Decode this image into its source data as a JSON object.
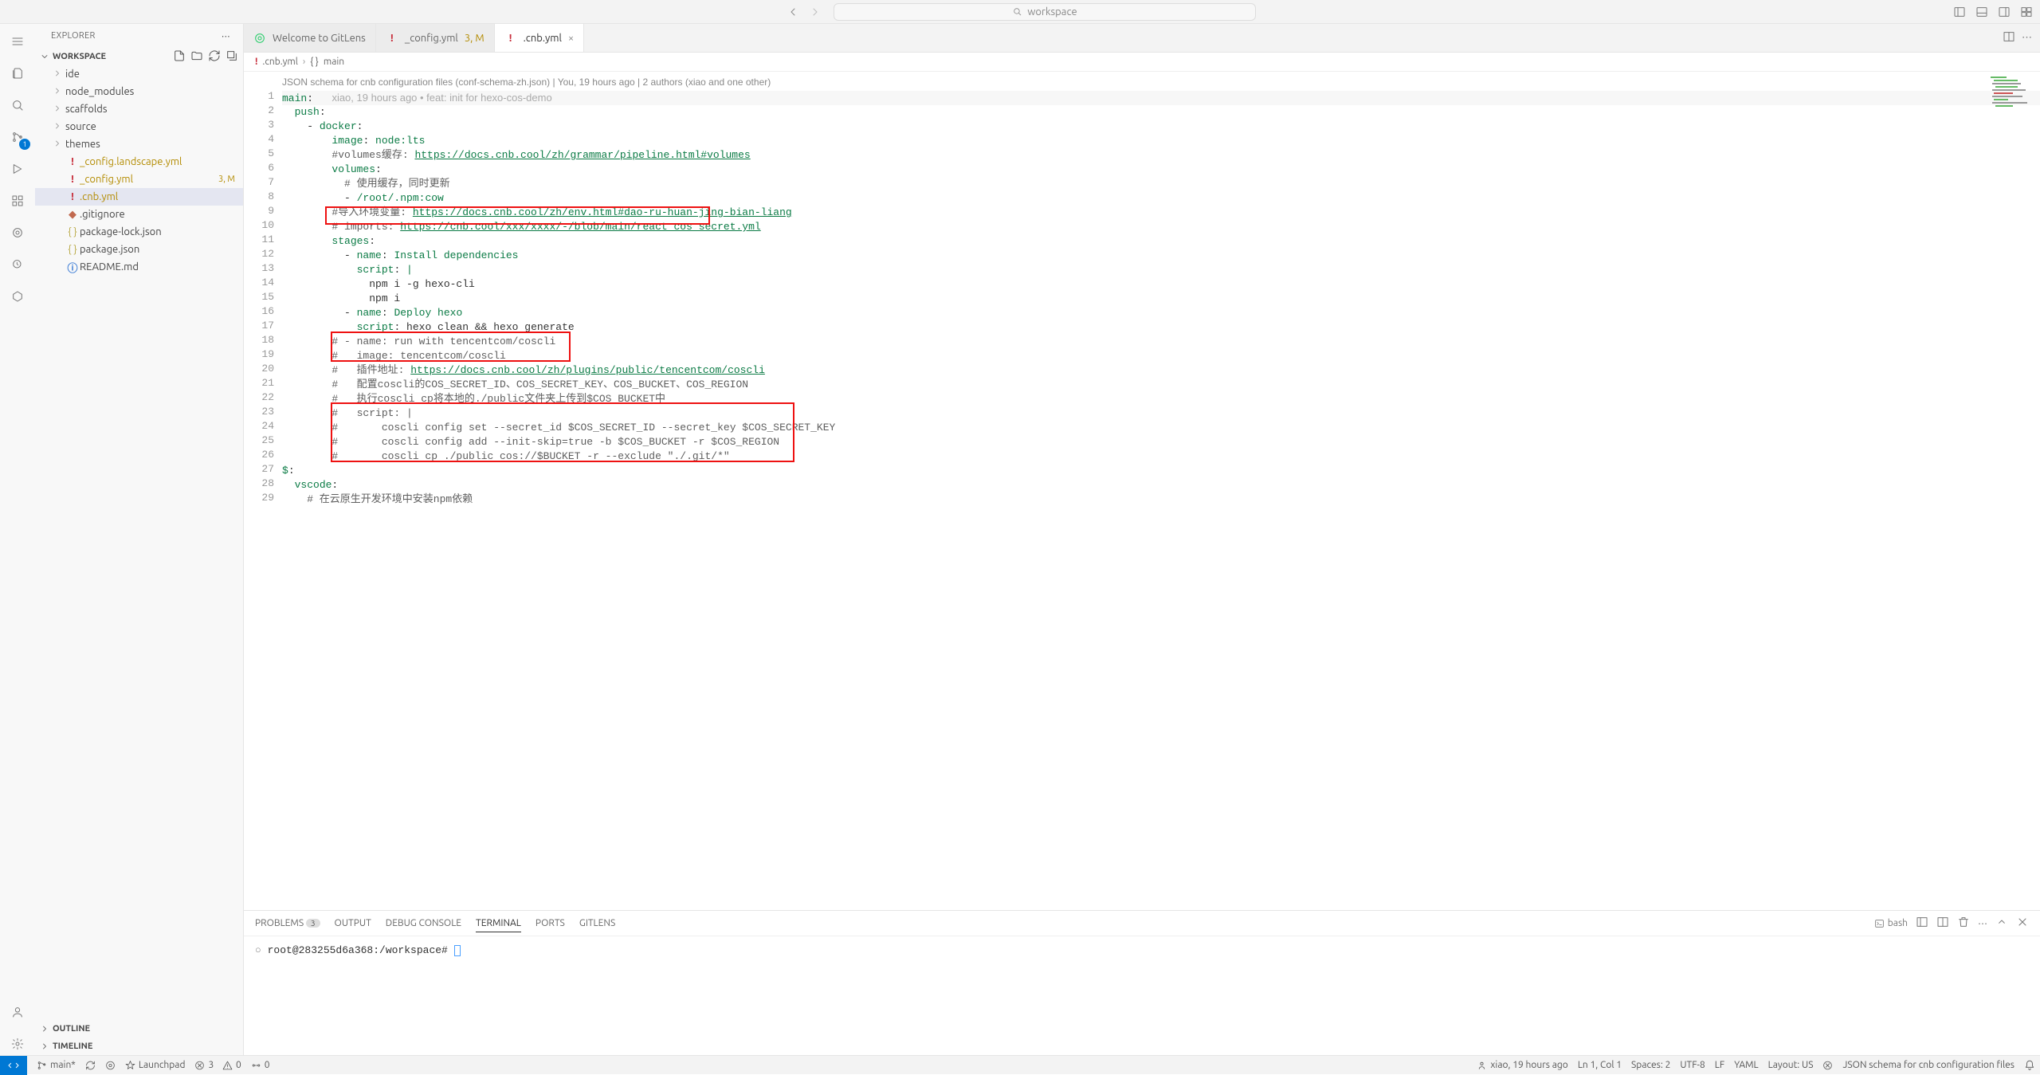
{
  "title": {
    "search_placeholder": "workspace"
  },
  "sidebar": {
    "title": "EXPLORER",
    "sections": {
      "workspace": "WORKSPACE",
      "outline": "OUTLINE",
      "timeline": "TIMELINE"
    },
    "tree": {
      "folders": [
        "ide",
        "node_modules",
        "scaffolds",
        "source",
        "themes"
      ],
      "files": [
        {
          "name": "_config.landscape.yml",
          "modified": true
        },
        {
          "name": "_config.yml",
          "modified": true,
          "suffix": "3, M"
        },
        {
          "name": ".cnb.yml",
          "modified": true,
          "selected": true
        },
        {
          "name": ".gitignore"
        },
        {
          "name": "package-lock.json"
        },
        {
          "name": "package.json"
        },
        {
          "name": "README.md"
        }
      ]
    }
  },
  "tabs": [
    {
      "label": "Welcome to GitLens",
      "icon": "gitlens"
    },
    {
      "label": "_config.yml",
      "suffix": "3, M",
      "icon": "yaml-orange"
    },
    {
      "label": ".cnb.yml",
      "icon": "yaml-orange",
      "active": true,
      "closable": true
    }
  ],
  "breadcrumbs": {
    "file": ".cnb.yml",
    "symbol": "main"
  },
  "schema_hint": "JSON schema for cnb configuration files (conf-schema-zh.json) | You, 19 hours ago | 2 authors (xiao and one other)",
  "blame_first": "xiao, 19 hours ago • feat: init for hexo-cos-demo",
  "code": [
    "main:",
    "  push:",
    "    - docker:",
    "        image: node:lts",
    "        #volumes缓存: https://docs.cnb.cool/zh/grammar/pipeline.html#volumes",
    "        volumes:",
    "          # 使用缓存，同时更新",
    "          - /root/.npm:cow",
    "        #导入环境变量: https://docs.cnb.cool/zh/env.html#dao-ru-huan-jing-bian-liang",
    "        # imports: https://cnb.cool/xxx/xxxx/-/blob/main/react_cos_secret.yml",
    "        stages:",
    "          - name: Install dependencies",
    "            script: |",
    "              npm i -g hexo-cli",
    "              npm i",
    "          - name: Deploy hexo",
    "            script: hexo clean && hexo generate",
    "        # - name: run with tencentcom/coscli",
    "        #   image: tencentcom/coscli",
    "        #   插件地址: https://docs.cnb.cool/zh/plugins/public/tencentcom/coscli",
    "        #   配置coscli的COS_SECRET_ID、COS_SECRET_KEY、COS_BUCKET、COS_REGION",
    "        #   执行coscli cp将本地的./public文件夹上传到$COS_BUCKET中",
    "        #   script: |",
    "        #       coscli config set --secret_id $COS_SECRET_ID --secret_key $COS_SECRET_KEY",
    "        #       coscli config add --init-skip=true -b $COS_BUCKET -r $COS_REGION",
    "        #       coscli cp ./public cos://$BUCKET -r --exclude \"./.git/*\"",
    "$:",
    "  vscode:",
    "    # 在云原生开发环境中安装npm依赖"
  ],
  "panel": {
    "tabs": {
      "problems": "PROBLEMS",
      "output": "OUTPUT",
      "debug": "DEBUG CONSOLE",
      "terminal": "TERMINAL",
      "ports": "PORTS",
      "gitlens": "GITLENS"
    },
    "problems_count": "3",
    "terminal_kind": "bash",
    "prompt": "root@283255d6a368:/workspace# "
  },
  "status": {
    "branch": "main*",
    "sync_label": "",
    "launchpad": "Launchpad",
    "errors": "3",
    "warnings": "0",
    "ports": "0",
    "blame": "xiao, 19 hours ago",
    "cursor": "Ln 1, Col 1",
    "spaces": "Spaces: 2",
    "encoding": "UTF-8",
    "eol": "LF",
    "lang": "YAML",
    "layout": "Layout: US",
    "schema": "JSON schema for cnb configuration files"
  },
  "scm_badge": "1"
}
